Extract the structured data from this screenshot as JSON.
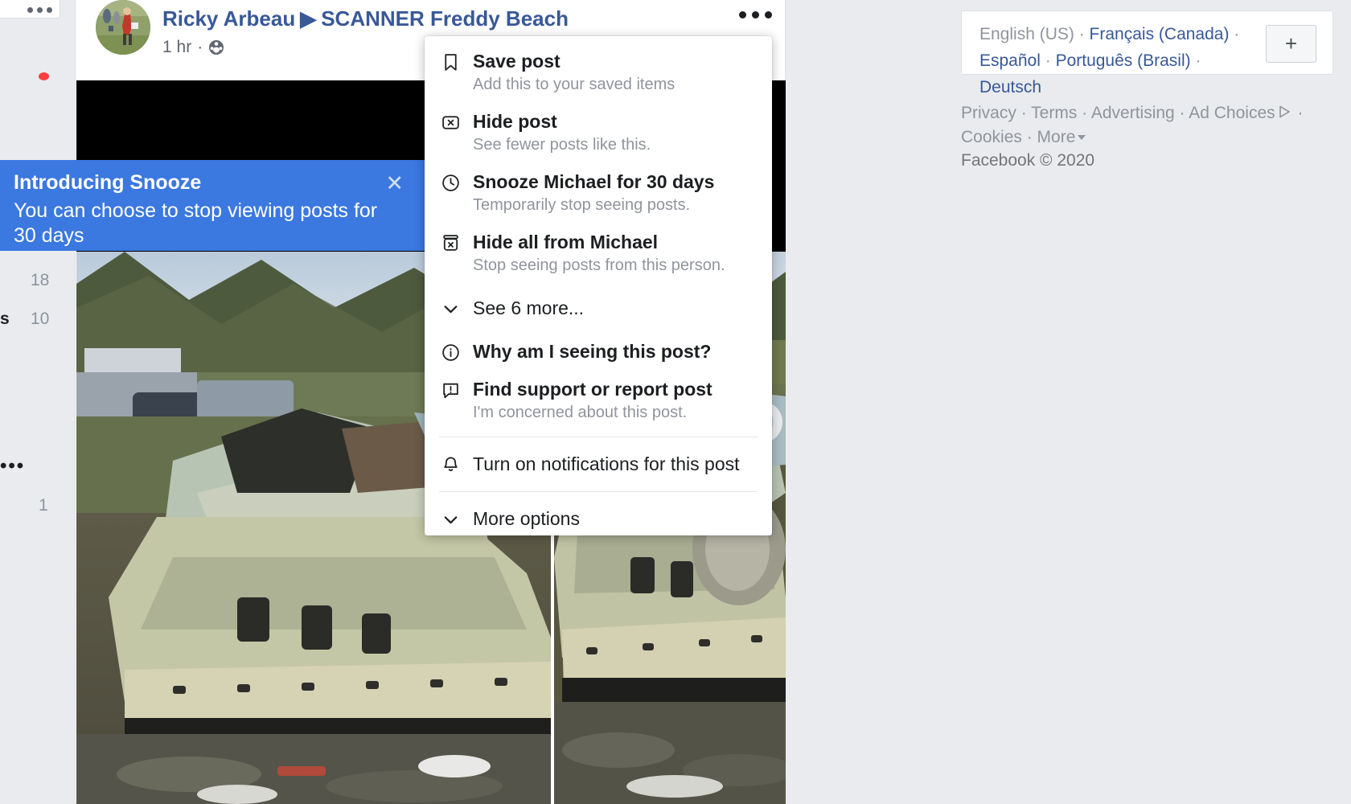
{
  "left_rail": {
    "card_menu_icon": "ellipsis-icon",
    "notification_dot": "red-dot-indicator",
    "counts": {
      "eighteen": "18",
      "ten": "10",
      "one": "1"
    },
    "letter": "s",
    "ellipsis": "•••"
  },
  "post": {
    "author": "Ricky Arbeau",
    "arrow": "▶",
    "target": "SCANNER Freddy Beach",
    "time": "1 hr",
    "time_separator": "·",
    "audience_icon": "friends-globe-icon",
    "menu_icon": "ellipsis-icon"
  },
  "snooze_tooltip": {
    "title": "Introducing Snooze",
    "body": "You can choose to stop viewing posts for 30 days",
    "close_icon": "close-icon"
  },
  "menu": {
    "items": [
      {
        "icon": "bookmark-icon",
        "title": "Save post",
        "subtitle": "Add this to your saved items",
        "bold": true
      },
      {
        "icon": "hide-post-icon",
        "title": "Hide post",
        "subtitle": "See fewer posts like this.",
        "bold": true
      },
      {
        "icon": "clock-icon",
        "title": "Snooze Michael for 30 days",
        "subtitle": "Temporarily stop seeing posts.",
        "bold": true
      },
      {
        "icon": "hide-all-icon",
        "title": "Hide all from Michael",
        "subtitle": "Stop seeing posts from this person.",
        "bold": true
      },
      {
        "icon": "chevron-down-icon",
        "title": "See 6 more...",
        "subtitle": "",
        "bold": false
      },
      {
        "icon": "info-icon",
        "title": "Why am I seeing this post?",
        "subtitle": "",
        "bold": true
      },
      {
        "icon": "report-icon",
        "title": "Find support or report post",
        "subtitle": "I'm concerned about this post.",
        "bold": true
      },
      {
        "icon": "bell-icon",
        "title": "Turn on notifications for this post",
        "subtitle": "",
        "bold": false
      },
      {
        "icon": "chevron-down-icon",
        "title": "More options",
        "subtitle": "",
        "bold": false
      }
    ]
  },
  "sidebar_right": {
    "languages": [
      {
        "label": "English (US)",
        "active": true
      },
      {
        "label": "Français (Canada)",
        "active": false
      },
      {
        "label": "Español",
        "active": false
      },
      {
        "label": "Português (Brasil)",
        "active": false
      },
      {
        "label": "Deutsch",
        "active": false
      }
    ],
    "add_language_label": "+",
    "footer_links_row1": [
      "Privacy",
      "Terms",
      "Advertising",
      "Ad Choices"
    ],
    "footer_links_row2": [
      "Cookies",
      "More"
    ],
    "adchoices_icon": "ad-choices-icon",
    "more_caret_icon": "caret-down-icon",
    "copyright": "Facebook © 2020"
  },
  "colors": {
    "accent_blue": "#3b78e0",
    "link_blue": "#385898",
    "page_bg": "#e9ebee",
    "muted": "#90949c",
    "red_dot": "#fa3e3e"
  }
}
